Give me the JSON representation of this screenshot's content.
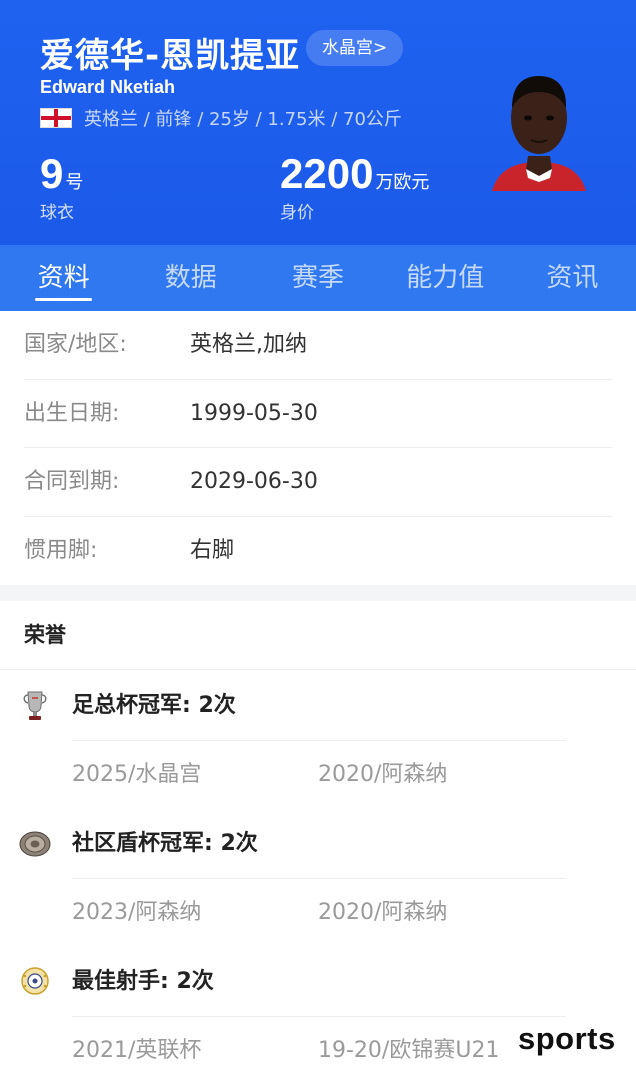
{
  "player": {
    "name_cn": "爱德华-恩凯提亚",
    "club_link": "水晶宫>",
    "name_en": "Edward Nketiah",
    "meta": "英格兰 / 前锋 / 25岁 / 1.75米 / 70公斤",
    "shirt_number": "9",
    "shirt_unit": "号",
    "shirt_label": "球衣",
    "value": "2200",
    "value_unit": "万欧元",
    "value_label": "身价"
  },
  "tabs": [
    {
      "label": "资料",
      "active": true
    },
    {
      "label": "数据",
      "active": false
    },
    {
      "label": "赛季",
      "active": false
    },
    {
      "label": "能力值",
      "active": false
    },
    {
      "label": "资讯",
      "active": false
    }
  ],
  "info": [
    {
      "key": "国家/地区:",
      "value": "英格兰,加纳"
    },
    {
      "key": "出生日期:",
      "value": "1999-05-30"
    },
    {
      "key": "合同到期:",
      "value": "2029-06-30"
    },
    {
      "key": "惯用脚:",
      "value": "右脚"
    }
  ],
  "honors": {
    "title": "荣誉",
    "items": [
      {
        "icon": "fa-cup-icon",
        "title": "足总杯冠军: 2次",
        "entries": [
          "2025/水晶宫",
          "2020/阿森纳"
        ]
      },
      {
        "icon": "community-shield-icon",
        "title": "社区盾杯冠军: 2次",
        "entries": [
          "2023/阿森纳",
          "2020/阿森纳"
        ]
      },
      {
        "icon": "top-scorer-icon",
        "title": "最佳射手: 2次",
        "entries": [
          "2021/英联杯",
          "19-20/欧锦赛U21"
        ]
      }
    ]
  },
  "watermark": "sports",
  "colors": {
    "header": "#1f62f0",
    "tabs": "#2f78f0"
  }
}
